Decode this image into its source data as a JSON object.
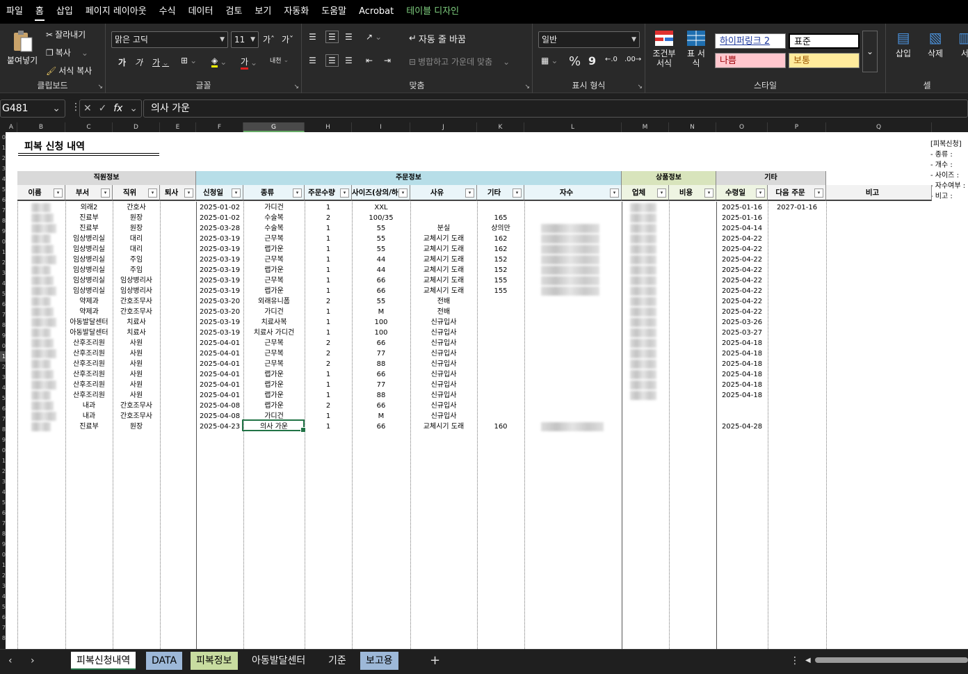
{
  "menu": [
    "파일",
    "홈",
    "삽입",
    "페이지 레이아웃",
    "수식",
    "데이터",
    "검토",
    "보기",
    "자동화",
    "도움말",
    "Acrobat",
    "테이블 디자인"
  ],
  "ribbon": {
    "clipboard": {
      "paste": "붙여넣기",
      "cut": "잘라내기",
      "copy": "복사",
      "format_painter": "서식 복사",
      "label": "클립보드"
    },
    "font": {
      "name": "맑은 고딕",
      "size": "11",
      "grow": "가ˆ",
      "shrink": "가ˇ",
      "bold": "가",
      "italic": "가",
      "underline": "가",
      "fontcolor": "가",
      "phonetic": "내천",
      "label": "글꼴"
    },
    "align": {
      "wrap": "자동 줄 바꿈",
      "merge": "병합하고 가운데 맞춤",
      "label": "맞춤"
    },
    "number": {
      "format": "일반",
      "percent": "%",
      "comma": "9",
      "label": "표시 형식"
    },
    "styles": {
      "conditional": "조건부 서식",
      "table": "표 서식",
      "s1": "하이퍼링크 2",
      "s2": "표준",
      "s3": "나쁨",
      "s4": "보통",
      "label": "스타일"
    },
    "cells": {
      "insert": "삽입",
      "delete": "삭제",
      "format": "서",
      "label": "셀"
    }
  },
  "formula_bar": {
    "name_box": "G481",
    "formula": "의사 가운"
  },
  "columns": [
    "A",
    "B",
    "C",
    "D",
    "E",
    "F",
    "G",
    "H",
    "I",
    "J",
    "K",
    "L",
    "M",
    "N",
    "O",
    "P",
    "Q"
  ],
  "row_numbers": [
    "0",
    "1",
    "2",
    "3",
    "4",
    "5",
    "6",
    "7",
    "8",
    "9",
    "0",
    "1",
    "2",
    "3",
    "4",
    "5",
    "6",
    "7",
    "8",
    "9",
    "0",
    "1",
    "2",
    "3",
    "4",
    "5",
    "6",
    "7",
    "8",
    "9",
    "0",
    "1",
    "2",
    "3",
    "4",
    "5",
    "6",
    "7",
    "8",
    "9",
    "0",
    "1",
    "2",
    "3",
    "4",
    "5",
    "6",
    "7",
    "8"
  ],
  "sheet": {
    "title": "피복 신청 내역",
    "notes": [
      "[피복신청]",
      "- 종류 :",
      "- 개수 :",
      "- 사이즈 :",
      "- 자수여부 :",
      "- 비고 :"
    ],
    "groups": [
      "직원정보",
      "주문정보",
      "상품정보",
      "기타"
    ],
    "headers": [
      "이름",
      "부서",
      "직위",
      "퇴사",
      "신청일",
      "종류",
      "주문수량",
      "사이즈(상의/하",
      "사유",
      "기타",
      "자수",
      "업체",
      "비용",
      "수령일",
      "다음 주문",
      "비고"
    ],
    "rows": [
      [
        "외래2",
        "간호사",
        "2025-01-02",
        "가디건",
        "1",
        "XXL",
        "",
        "",
        "2025-01-16",
        "2027-01-16"
      ],
      [
        "진료부",
        "원장",
        "2025-01-02",
        "수술복",
        "2",
        "100/35",
        "",
        "165",
        "2025-01-16",
        ""
      ],
      [
        "진료부",
        "원장",
        "2025-03-28",
        "수술복",
        "1",
        "55",
        "분실",
        "상의만",
        "2025-04-14",
        ""
      ],
      [
        "임상병리실",
        "대리",
        "2025-03-19",
        "근무복",
        "1",
        "55",
        "교체시기 도래",
        "162",
        "2025-04-22",
        ""
      ],
      [
        "임상병리실",
        "대리",
        "2025-03-19",
        "랩가운",
        "1",
        "55",
        "교체시기 도래",
        "162",
        "2025-04-22",
        ""
      ],
      [
        "임상병리실",
        "주임",
        "2025-03-19",
        "근무복",
        "1",
        "44",
        "교체시기 도래",
        "152",
        "2025-04-22",
        ""
      ],
      [
        "임상병리실",
        "주임",
        "2025-03-19",
        "랩가운",
        "1",
        "44",
        "교체시기 도래",
        "152",
        "2025-04-22",
        ""
      ],
      [
        "임상병리실",
        "임상병리사",
        "2025-03-19",
        "근무복",
        "1",
        "66",
        "교체시기 도래",
        "155",
        "2025-04-22",
        ""
      ],
      [
        "임상병리실",
        "임상병리사",
        "2025-03-19",
        "랩가운",
        "1",
        "66",
        "교체시기 도래",
        "155",
        "2025-04-22",
        ""
      ],
      [
        "약제과",
        "간호조무사",
        "2025-03-20",
        "외래유니폼",
        "2",
        "55",
        "전배",
        "",
        "2025-04-22",
        ""
      ],
      [
        "약제과",
        "간호조무사",
        "2025-03-20",
        "가디건",
        "1",
        "M",
        "전배",
        "",
        "2025-04-22",
        ""
      ],
      [
        "아동발달센터",
        "치료사",
        "2025-03-19",
        "치료사복",
        "1",
        "100",
        "신규입사",
        "",
        "2025-03-26",
        ""
      ],
      [
        "아동발달센터",
        "치료사",
        "2025-03-19",
        "치료사 가디건",
        "1",
        "100",
        "신규입사",
        "",
        "2025-03-27",
        ""
      ],
      [
        "산후조리원",
        "사원",
        "2025-04-01",
        "근무복",
        "2",
        "66",
        "신규입사",
        "",
        "2025-04-18",
        ""
      ],
      [
        "산후조리원",
        "사원",
        "2025-04-01",
        "근무복",
        "2",
        "77",
        "신규입사",
        "",
        "2025-04-18",
        ""
      ],
      [
        "산후조리원",
        "사원",
        "2025-04-01",
        "근무복",
        "2",
        "88",
        "신규입사",
        "",
        "2025-04-18",
        ""
      ],
      [
        "산후조리원",
        "사원",
        "2025-04-01",
        "랩가운",
        "1",
        "66",
        "신규입사",
        "",
        "2025-04-18",
        ""
      ],
      [
        "산후조리원",
        "사원",
        "2025-04-01",
        "랩가운",
        "1",
        "77",
        "신규입사",
        "",
        "2025-04-18",
        ""
      ],
      [
        "산후조리원",
        "사원",
        "2025-04-01",
        "랩가운",
        "1",
        "88",
        "신규입사",
        "",
        "2025-04-18",
        ""
      ],
      [
        "내과",
        "간호조무사",
        "2025-04-08",
        "랩가운",
        "2",
        "66",
        "신규입사",
        "",
        "",
        ""
      ],
      [
        "내과",
        "간호조무사",
        "2025-04-08",
        "가디건",
        "1",
        "M",
        "신규입사",
        "",
        "",
        ""
      ],
      [
        "진료부",
        "원장",
        "2025-04-23",
        "의사 가운",
        "1",
        "66",
        "교체시기 도래",
        "160",
        "2025-04-28",
        ""
      ]
    ]
  },
  "tabs": [
    "피복신청내역",
    "DATA",
    "피복정보",
    "아동발달센터",
    "기준",
    "보고용"
  ],
  "tab_colors": {
    "DATA": "#9db8d8",
    "피복정보": "#c8dca0",
    "보고용": "#9db8d8"
  }
}
